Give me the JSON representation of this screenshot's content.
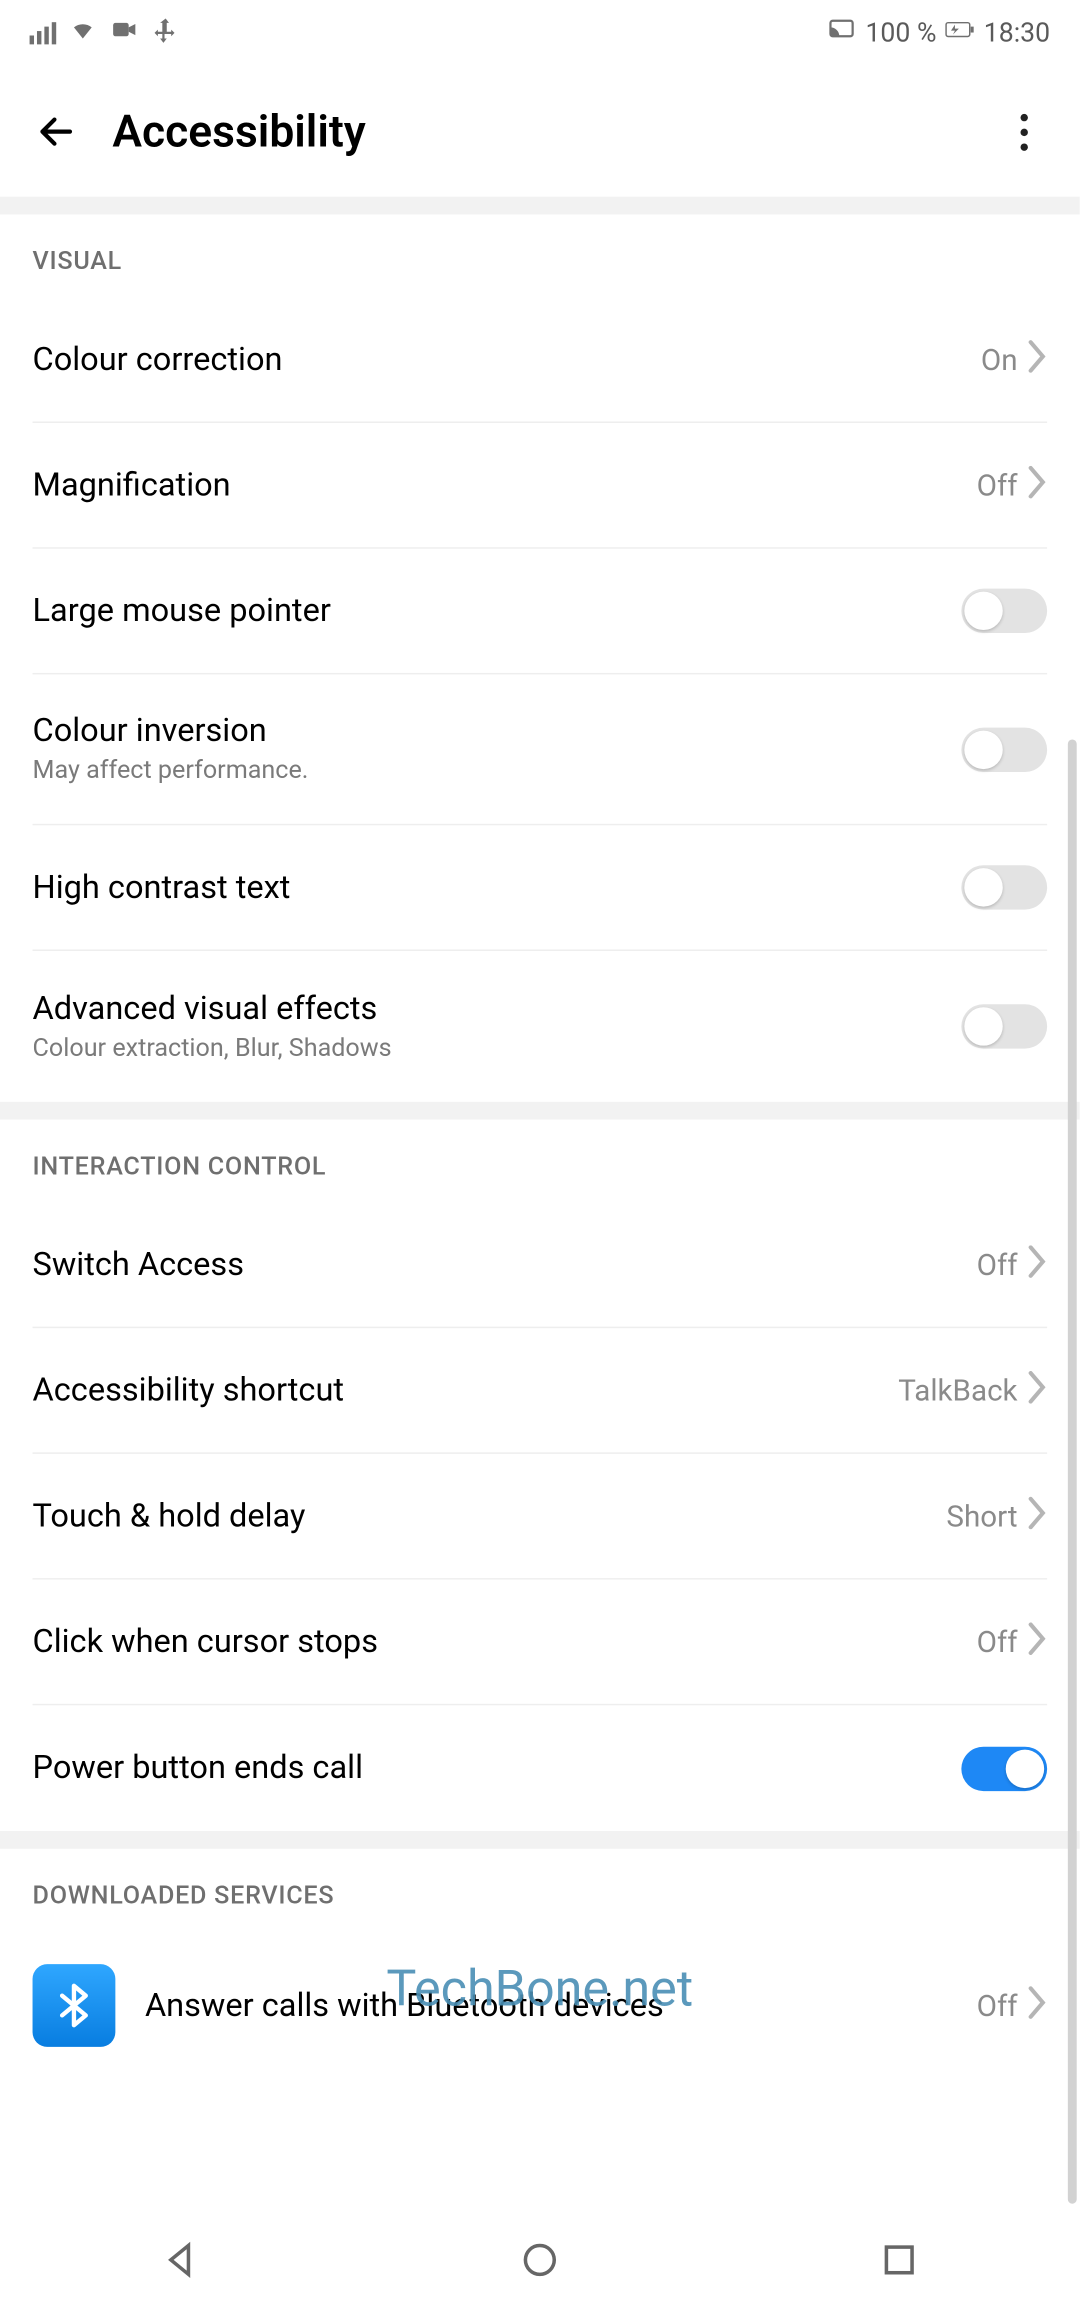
{
  "statusbar": {
    "battery_text": "100 %",
    "time": "18:30"
  },
  "header": {
    "title": "Accessibility"
  },
  "sections": {
    "visual": {
      "header": "VISUAL",
      "colour_correction": {
        "label": "Colour correction",
        "value": "On"
      },
      "magnification": {
        "label": "Magnification",
        "value": "Off"
      },
      "large_pointer": {
        "label": "Large mouse pointer"
      },
      "colour_inversion": {
        "label": "Colour inversion",
        "sub": "May affect performance."
      },
      "high_contrast": {
        "label": "High contrast text"
      },
      "adv_visual": {
        "label": "Advanced visual effects",
        "sub": "Colour extraction, Blur, Shadows"
      }
    },
    "interaction": {
      "header": "INTERACTION CONTROL",
      "switch_access": {
        "label": "Switch Access",
        "value": "Off"
      },
      "a11y_shortcut": {
        "label": "Accessibility shortcut",
        "value": "TalkBack"
      },
      "touch_delay": {
        "label": "Touch & hold delay",
        "value": "Short"
      },
      "click_cursor": {
        "label": "Click when cursor stops",
        "value": "Off"
      },
      "power_end_call": {
        "label": "Power button ends call"
      }
    },
    "downloaded": {
      "header": "DOWNLOADED SERVICES",
      "bt_calls": {
        "label": "Answer calls with Bluetooth devices",
        "value": "Off"
      }
    }
  },
  "watermark": "TechBone.net"
}
